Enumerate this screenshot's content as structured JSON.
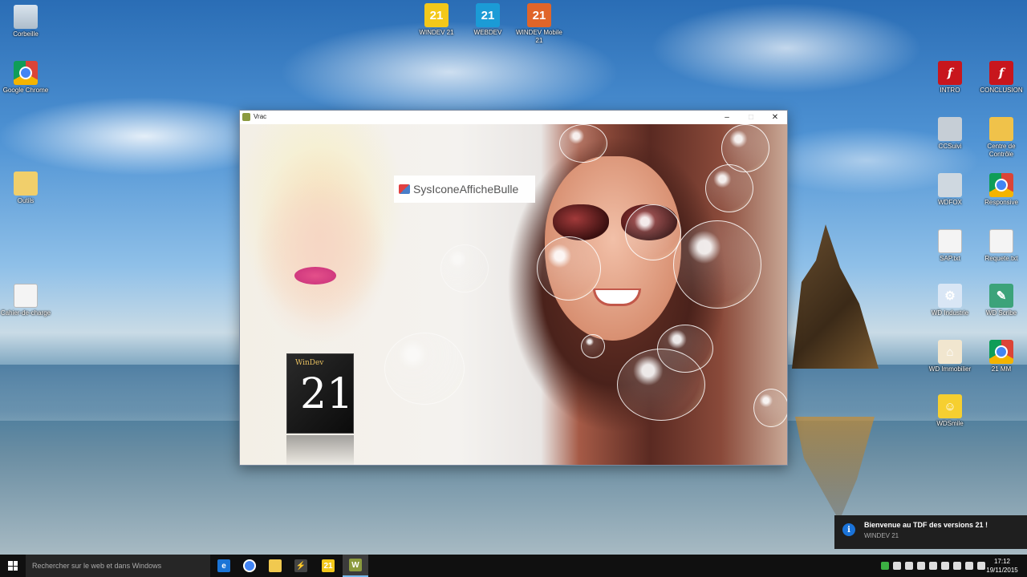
{
  "desktop": {
    "icons": [
      {
        "label": "Corbeille"
      },
      {
        "label": "Google Chrome"
      },
      {
        "label": "Outils"
      },
      {
        "label": "Cahier-de-charge"
      },
      {
        "label": "WINDEV 21"
      },
      {
        "label": "WEBDEV"
      },
      {
        "label": "WINDEV Mobile 21"
      },
      {
        "label": "INTRO"
      },
      {
        "label": "CONCLUSION"
      },
      {
        "label": "CCSuivi"
      },
      {
        "label": "Centre de Contrôle"
      },
      {
        "label": "WDFOX"
      },
      {
        "label": "Responsive"
      },
      {
        "label": "SAP.txt"
      },
      {
        "label": "Requete.txt"
      },
      {
        "label": "WD Industrie"
      },
      {
        "label": "WD Scribe"
      },
      {
        "label": "WD Immobilier"
      },
      {
        "label": "21 MM"
      },
      {
        "label": "WDSmile"
      }
    ]
  },
  "window": {
    "title": "Vrac",
    "controls": {
      "minimize": "–",
      "maximize": "□",
      "close": "✕"
    },
    "tooltip_text": "SysIconeAfficheBulle",
    "product": {
      "brand": "WinDev",
      "version": "21"
    }
  },
  "notification": {
    "title": "Bienvenue au TDF des versions 21 !",
    "subtitle": "WINDEV 21",
    "icon": "info-icon"
  },
  "taskbar": {
    "search_placeholder": "Rechercher sur le web et dans Windows",
    "clock_time": "17:12",
    "clock_date": "19/11/2015"
  }
}
